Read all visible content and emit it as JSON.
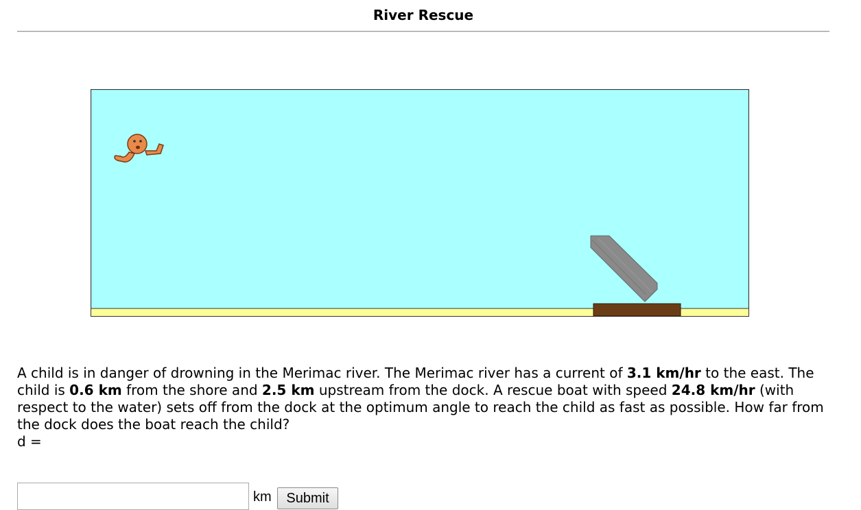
{
  "page": {
    "title": "River Rescue"
  },
  "scene": {
    "water_color": "#aaffff",
    "shore_color": "#ffff99",
    "dock_color": "#6b3d17",
    "boat_color": "#8a8a8a",
    "child_color": "#e88a4a",
    "child_icon": "drowning-child-icon",
    "boat_icon": "rescue-boat-icon",
    "dock_icon": "dock-icon"
  },
  "problem": {
    "p1": "A child is in danger of drowning in the Merimac river. The Merimac river has a current of ",
    "current": "3.1 km/hr",
    "p2": " to the east. The child is ",
    "distance_from_shore": "0.6 km",
    "p3": " from the shore and ",
    "upstream_distance": "2.5 km",
    "p4": " upstream from the dock. A rescue boat with speed ",
    "boat_speed": "24.8 km/hr",
    "p5": " (with respect to the water) sets off from the dock at the optimum angle to reach the child as fast as possible. How far from the dock does the boat reach the child?"
  },
  "answer": {
    "variable_label": "d =",
    "value": "",
    "placeholder": "",
    "unit": "km",
    "submit_label": "Submit"
  }
}
